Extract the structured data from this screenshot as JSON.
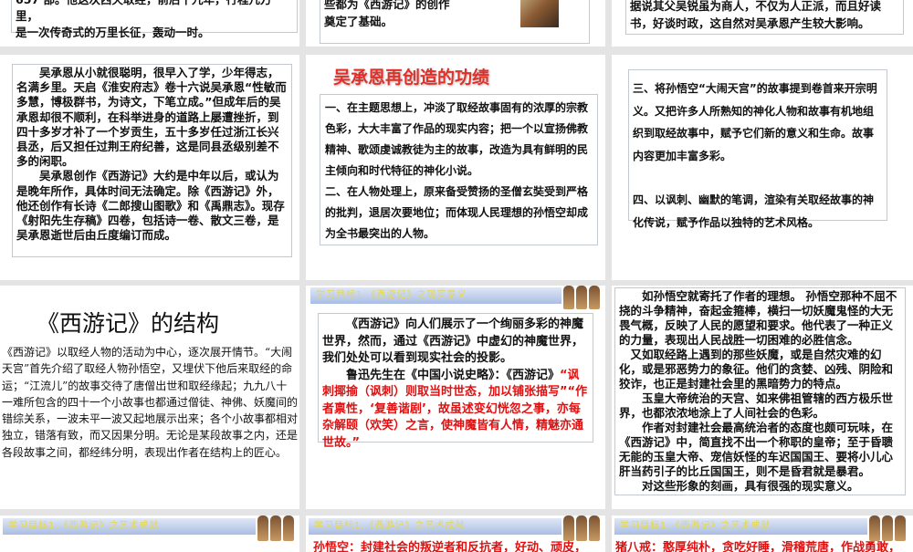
{
  "row1": {
    "s1": [
      "657 部。他这次西天取经，前后十九年，行程几万里，",
      "是一次传奇式的万里长征，轰动一时。"
    ],
    "s2": [
      "些都为《西游记》的创作",
      "奠定了基础。"
    ],
    "s3": [
      "据说其父吴锐虽为商人，不仅为人正派，而且好读",
      "书，好谈时政，这自然对吴承恩产生较大影响。"
    ]
  },
  "s4": {
    "p1": "吴承恩从小就很聪明，很早入了学，少年得志，名满乡里。天启《淮安府志》卷十六说吴承恩“性敏而多慧，博极群书，为诗文，下笔立成。”但成年后的吴承恩却很不顺利，在科举进身的道路上屡遭挫折，到四十多岁才补了一个岁贡生，五十多岁任过浙江长兴县丞，后又担任过荆王府纪善，这是同县丞级别差不多的闲职。",
    "p2": "吴承恩创作《西游记》大约是中年以后，或认为是晚年所作，具体时间无法确定。除《西游记》外，他还创作有长诗《二郎搜山图歌》和《禹鼎志》。现存《射阳先生存稿》四卷，包括诗一卷、散文三卷，是吴承恩逝世后由丘度编订而成。"
  },
  "s5": {
    "title": "吴承恩再创造的功绩",
    "p1": "一、在主题思想上，冲淡了取经故事固有的浓厚的宗教色彩，大大丰富了作品的现实内容；把一个以宣扬佛教精神、歌颂虔诚教徒为主的故事，改造为具有鲜明的民主倾向和时代特征的神化小说。",
    "p2": "二、在人物处理上，原来备受赞扬的圣僧玄奘受到严格的批判，退居次要地位；而体现人民理想的孙悟空却成为全书最突出的人物。"
  },
  "s6": {
    "p1": "三、将孙悟空“大闹天宫”的故事提到卷首来开宗明义。又把许多人所熟知的神化人物和故事有机地组织到取经故事中，赋予它们新的意义和生命。故事内容更加丰富多彩。",
    "p2": "四、以讽刺、幽默的笔调，渲染有关取经故事的神化传说，赋予作品以独特的艺术风格。"
  },
  "s7": {
    "title": "《西游记》的结构",
    "body": "《西游记》以取经人物的活动为中心，逐次展开情节。“大闹天宫”首先介绍了取经人物孙悟空，又埋伏下他后来取经的命运；“江流儿”的故事交待了唐僧出世和取经缘起；九九八十一难所包含的四十一个小故事也都通过僧徒、神佛、妖魔间的错综关系，一波未平一波又起地展示出来；各个小故事都相对独立，错落有致，而又因果分明。无论是某段故事之内，还是各段故事之间，都经纬分明，表现出作者在结构上的匠心。"
  },
  "s8": {
    "banner": "学习目标1.《西游记》之现实意义",
    "p1": "《西游记》向人们展示了一个绚丽多彩的神魔世界，然而，通过《西游记》中虚幻的神魔世界，我们处处可以看到现实社会的投影。",
    "p2a": "鲁迅先生在《中国小说史略》：《西游记》",
    "p2b": "“讽刺揶揄（讽刺）则取当时世态，加以铺张描写”“作者禀性，‘复善谐剧’，故虽述变幻恍忽之事，亦每杂解颐（欢笑）之言，使神魔皆有人情，精魅亦通世故。”"
  },
  "s9": {
    "p1": "如孙悟空就寄托了作者的理想。 孙悟空那种不屈不挠的斗争精神，奋起金箍棒，横扫一切妖魔鬼怪的大无畏气概，反映了人民的愿望和要求。他代表了一种正义的力量，表现出人民战胜一切困难的必胜信念。",
    "p2": "又如取经路上遇到的那些妖魔，或是自然灾难的幻化，或是邪恶势力的象征。他们的贪婪、凶残、阴险和狡诈，也正是封建社会里的黑暗势力的特点。",
    "p3": "玉皇大帝统治的天宫、如来佛祖管辖的西方极乐世界，也都浓浓地涂上了人间社会的色彩。",
    "p4": "作者对封建社会最高统治者的态度也颇可玩味，在《西游记》中，简直找不出一个称职的皇帝；至于昏聩无能的玉皇大帝、宠信妖怪的车迟国国王、要将小儿心肝当药引子的比丘国国王，则不是昏君就是暴君。",
    "p5": "对这些形象的刻画，具有很强的现实意义。"
  },
  "row4": {
    "banner": "学习目标1.《西游记》之艺术成就",
    "s2": "孙悟空：封建社会的叛逆者和反抗者，好动、顽皮，",
    "s3": "猪八戒：憨厚纯朴，贪吃好睡，滑稽荒唐，作战勇敢，"
  },
  "colors": {
    "red": "#e01010",
    "bg": "#e4e4e4"
  }
}
